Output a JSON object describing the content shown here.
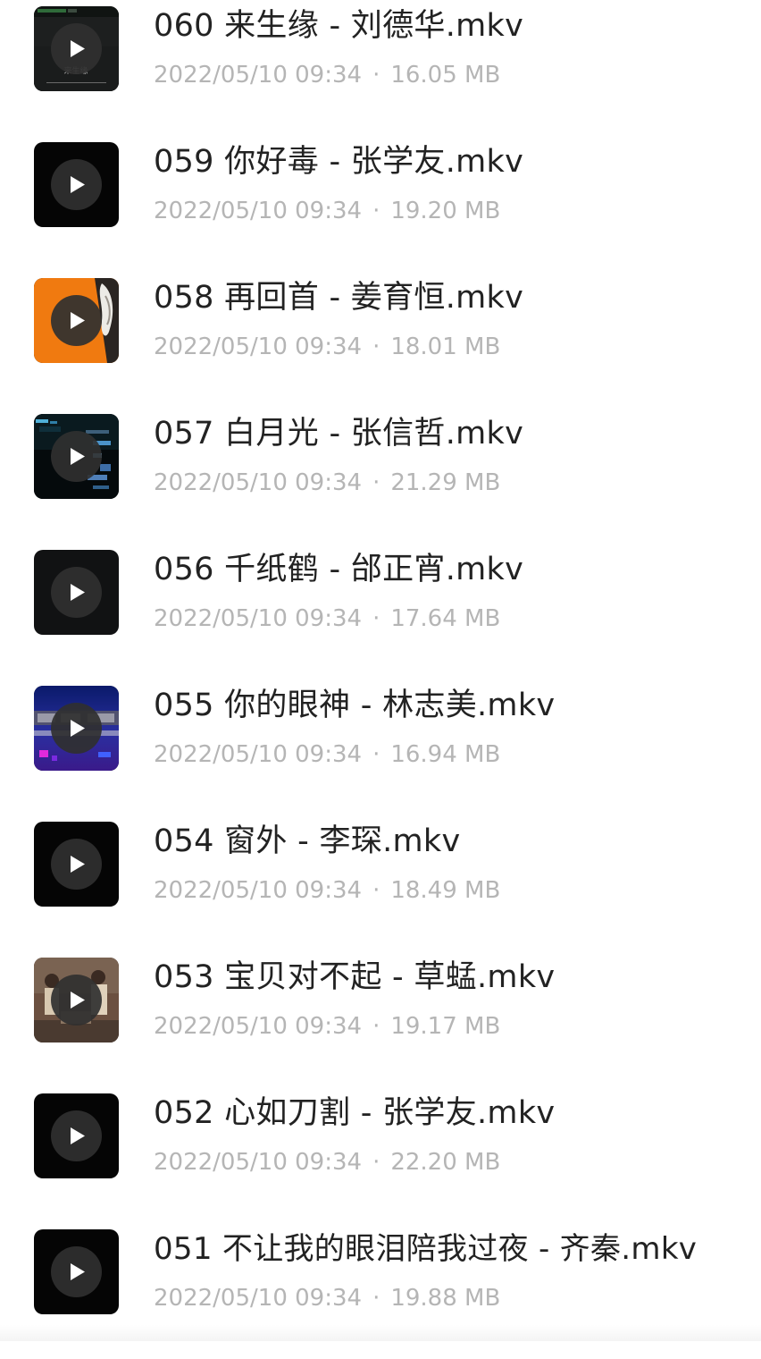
{
  "files": [
    {
      "title": "060 来生缘 - 刘德华.mkv",
      "date": "2022/05/10 09:34",
      "separator": "·",
      "size": "16.05 MB",
      "thumbnail_style": "dark-title-card",
      "thumbnail_caption": "来生缘",
      "icon": "play-icon"
    },
    {
      "title": "059 你好毒 - 张学友.mkv",
      "date": "2022/05/10 09:34",
      "separator": "·",
      "size": "19.20 MB",
      "thumbnail_style": "black",
      "icon": "play-icon"
    },
    {
      "title": "058 再回首 - 姜育恒.mkv",
      "date": "2022/05/10 09:34",
      "separator": "·",
      "size": "18.01 MB",
      "thumbnail_style": "orange-photo",
      "icon": "play-icon"
    },
    {
      "title": "057 白月光 - 张信哲.mkv",
      "date": "2022/05/10 09:34",
      "separator": "·",
      "size": "21.29 MB",
      "thumbnail_style": "blue-lyrics",
      "icon": "play-icon"
    },
    {
      "title": "056 千纸鹤 - 邰正宵.mkv",
      "date": "2022/05/10 09:34",
      "separator": "·",
      "size": "17.64 MB",
      "thumbnail_style": "black",
      "icon": "play-icon"
    },
    {
      "title": "055 你的眼神 - 林志美.mkv",
      "date": "2022/05/10 09:34",
      "separator": "·",
      "size": "16.94 MB",
      "thumbnail_style": "karaoke-blue-purple",
      "icon": "play-icon"
    },
    {
      "title": "054 窗外 - 李琛.mkv",
      "date": "2022/05/10 09:34",
      "separator": "·",
      "size": "18.49 MB",
      "thumbnail_style": "black",
      "icon": "play-icon"
    },
    {
      "title": "053 宝贝对不起 - 草蜢.mkv",
      "date": "2022/05/10 09:34",
      "separator": "·",
      "size": "19.17 MB",
      "thumbnail_style": "brown-group-photo",
      "icon": "play-icon"
    },
    {
      "title": "052 心如刀割 - 张学友.mkv",
      "date": "2022/05/10 09:34",
      "separator": "·",
      "size": "22.20 MB",
      "thumbnail_style": "black",
      "icon": "play-icon"
    },
    {
      "title": "051 不让我的眼泪陪我过夜 - 齐秦.mkv",
      "date": "2022/05/10 09:34",
      "separator": "·",
      "size": "19.88 MB",
      "thumbnail_style": "black",
      "icon": "play-icon"
    }
  ],
  "colors": {
    "title_text": "#222222",
    "meta_text": "#b5b5b5",
    "background": "#ffffff",
    "thumbnail_dark": "#050505",
    "orange_thumbnail": "#f07a10"
  }
}
